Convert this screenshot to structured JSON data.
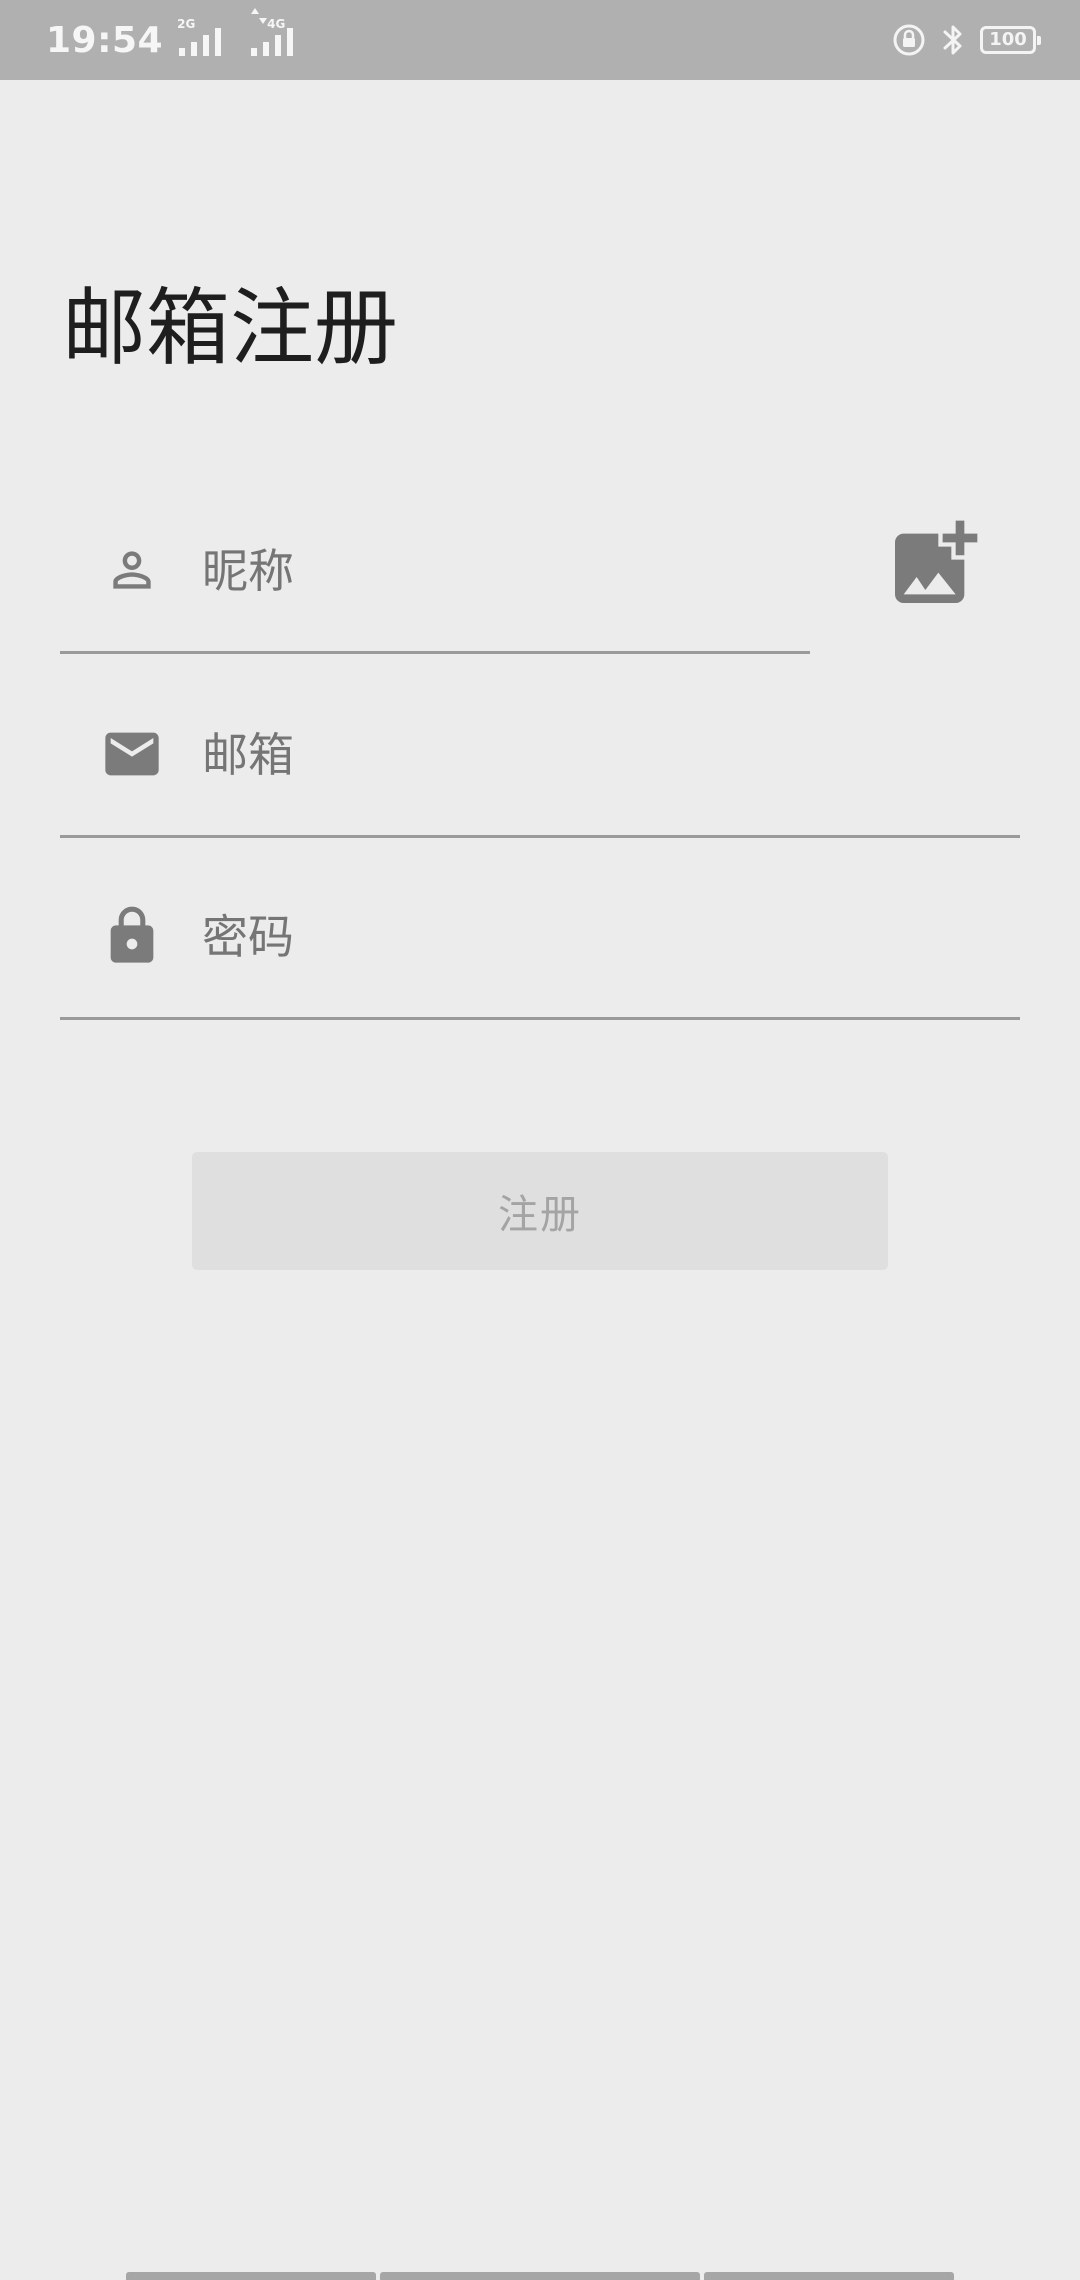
{
  "status_bar": {
    "time": "19:54",
    "signal_1_label": "2G",
    "signal_2_label": "4G",
    "battery_level": "100",
    "icons": [
      "rotation-lock-icon",
      "bluetooth-icon",
      "battery-icon"
    ]
  },
  "page": {
    "title": "邮箱注册"
  },
  "form": {
    "nickname": {
      "value": "",
      "placeholder": "昵称",
      "icon": "person-icon"
    },
    "email": {
      "value": "",
      "placeholder": "邮箱",
      "icon": "mail-icon"
    },
    "password": {
      "value": "",
      "placeholder": "密码",
      "icon": "lock-icon"
    },
    "avatar_icon": "add-photo-icon",
    "submit_label": "注册",
    "submit_enabled": false
  },
  "colors": {
    "background": "#ececec",
    "status_bar": "#b0b0b0",
    "title_text": "#1e1e1e",
    "icon": "#7b7b7b",
    "underline": "#9a9a9a",
    "button_bg": "#dfdfdf",
    "button_text": "#a4a4a4"
  }
}
